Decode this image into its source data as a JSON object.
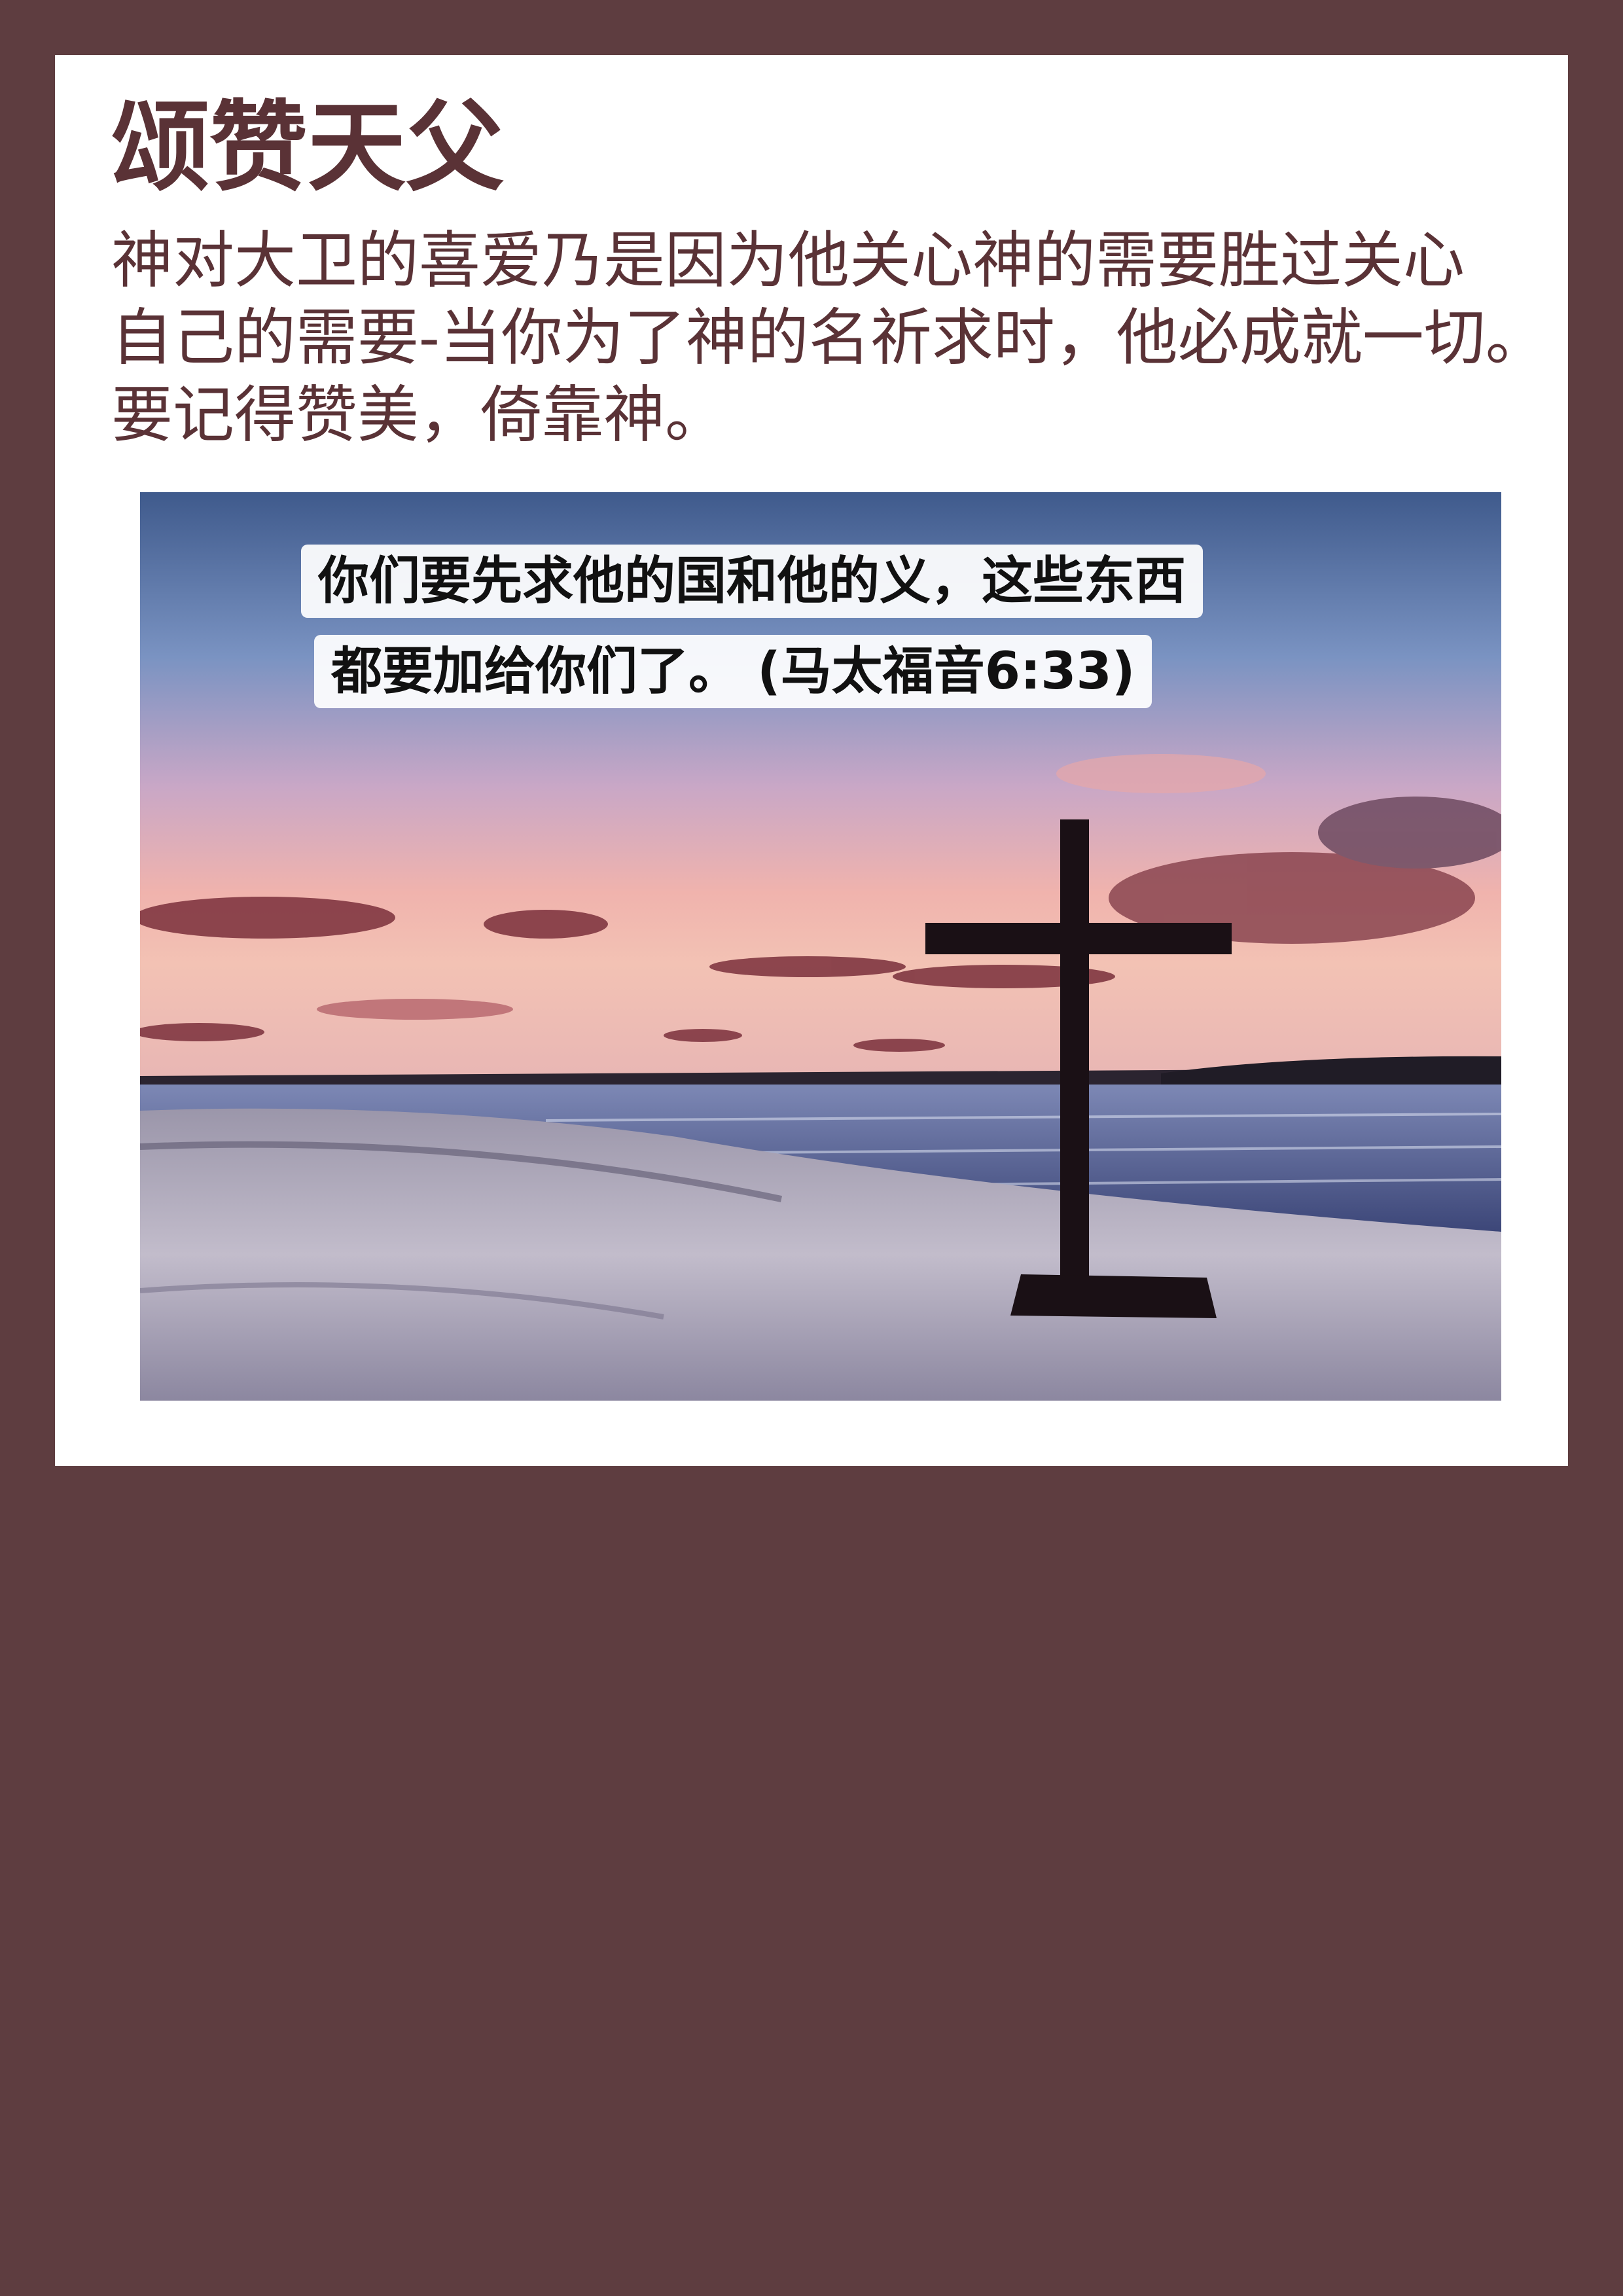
{
  "title": "颂赞天父",
  "paragraph": {
    "line1": "神对大卫的喜爱乃是因为他关心神的需要胜过关心",
    "line2": "自己的需要-当你为了神的名祈求时，他必成就一切。",
    "line3": "要记得赞美，倚靠神。"
  },
  "image": {
    "caption_line1": "你们要先求他的国和他的义，这些东西",
    "caption_line2": "都要加给你们了。  (马太福音6:33)"
  },
  "colors": {
    "page_background": "#5e3d40",
    "card_background": "#ffffff",
    "text": "#5a3236"
  }
}
